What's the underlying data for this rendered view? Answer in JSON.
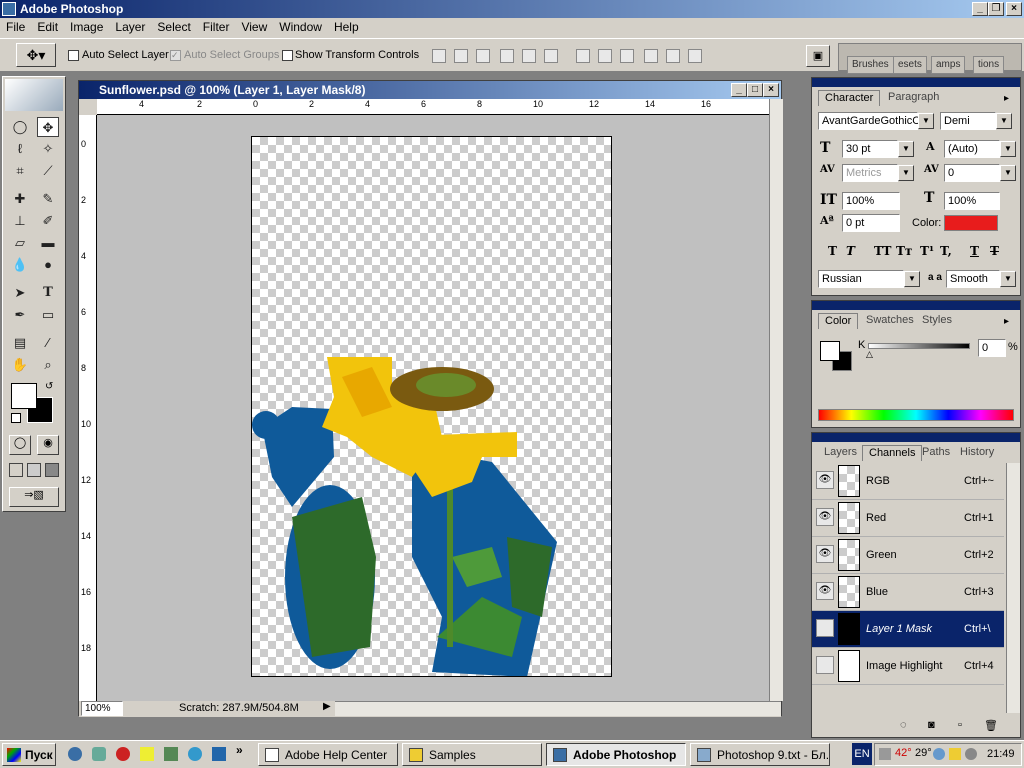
{
  "app": {
    "title": "Adobe Photoshop"
  },
  "menu": [
    "File",
    "Edit",
    "Image",
    "Layer",
    "Select",
    "Filter",
    "View",
    "Window",
    "Help"
  ],
  "options": {
    "auto_select_layer": "Auto Select Layer",
    "auto_select_groups": "Auto Select Groups",
    "show_transform_controls": "Show Transform Controls"
  },
  "palette_well": [
    "Brushes",
    "esets",
    "amps",
    "tions"
  ],
  "document": {
    "title": "Sunflower.psd @ 100% (Layer 1, Layer Mask/8)",
    "zoom": "100%",
    "scratch": "Scratch: 287.9M/504.8M",
    "ruler_h": [
      "4",
      "2",
      "0",
      "2",
      "4",
      "6",
      "8",
      "10",
      "12",
      "14",
      "16"
    ],
    "ruler_v": [
      "0",
      "2",
      "4",
      "6",
      "8",
      "10",
      "12",
      "14",
      "16",
      "18"
    ]
  },
  "character": {
    "tabs": [
      "Character",
      "Paragraph"
    ],
    "font_family": "AvantGardeGothicC",
    "font_style": "Demi",
    "size": "30 pt",
    "leading": "(Auto)",
    "kerning": "Metrics",
    "tracking": "0",
    "vscale": "100%",
    "hscale": "100%",
    "baseline": "0 pt",
    "color_label": "Color:",
    "color": "#e81c1c",
    "language": "Russian",
    "aa_label": "a a",
    "antialias": "Smooth",
    "style_buttons": [
      "T",
      "T",
      "TT",
      "Tт",
      "T¹",
      "T,",
      "T",
      "T"
    ]
  },
  "color_panel": {
    "tabs": [
      "Color",
      "Swatches",
      "Styles"
    ],
    "channel": "K",
    "value": "0",
    "unit": "%"
  },
  "channels_panel": {
    "tabs": [
      "Layers",
      "Channels",
      "Paths",
      "History"
    ],
    "rows": [
      {
        "name": "RGB",
        "shortcut": "Ctrl+~",
        "visible": "👁",
        "selected": false
      },
      {
        "name": "Red",
        "shortcut": "Ctrl+1",
        "visible": "👁",
        "selected": false
      },
      {
        "name": "Green",
        "shortcut": "Ctrl+2",
        "visible": "👁",
        "selected": false
      },
      {
        "name": "Blue",
        "shortcut": "Ctrl+3",
        "visible": "👁",
        "selected": false
      },
      {
        "name": "Layer 1 Mask",
        "shortcut": "Ctrl+\\",
        "visible": "",
        "selected": true
      },
      {
        "name": "Image Highlight",
        "shortcut": "Ctrl+4",
        "visible": "",
        "selected": false
      }
    ]
  },
  "taskbar": {
    "start": "Пуск",
    "buttons": [
      "Adobe Help Center",
      "Samples",
      "Adobe Photoshop",
      "Photoshop 9.txt - Бл..."
    ],
    "lang": "EN",
    "temp1": "42°",
    "temp2": "29°",
    "clock": "21:49",
    "chevron": "»"
  }
}
